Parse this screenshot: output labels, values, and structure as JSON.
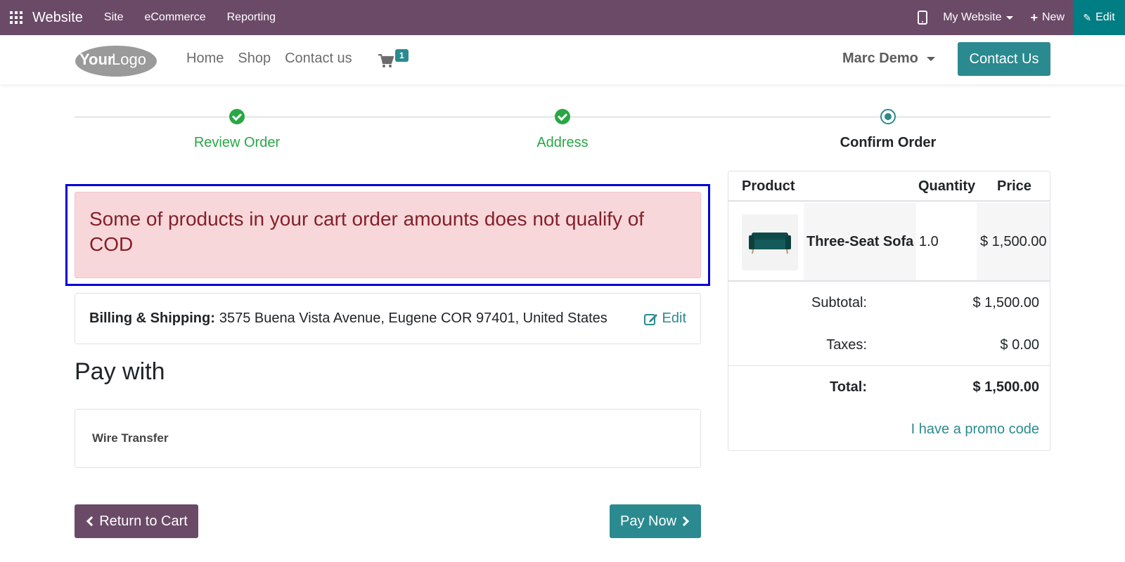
{
  "admin": {
    "brand": "Website",
    "menu": [
      "Site",
      "eCommerce",
      "Reporting"
    ],
    "site_selector": "My Website",
    "new_label": "New",
    "edit_label": "Edit",
    "bar_color": "#6b4a68",
    "edit_color": "#017e84"
  },
  "header": {
    "logo_text_bold": "Your",
    "logo_text": "Logo",
    "nav": [
      "Home",
      "Shop",
      "Contact us"
    ],
    "cart_count": "1",
    "user": "Marc Demo",
    "contact_button": "Contact Us",
    "accent": "#2b8a8f"
  },
  "wizard": {
    "steps": [
      {
        "label": "Review Order",
        "state": "done"
      },
      {
        "label": "Address",
        "state": "done"
      },
      {
        "label": "Confirm Order",
        "state": "current"
      }
    ]
  },
  "alert": {
    "message": "Some of products in your cart order amounts does not qualify of COD"
  },
  "billing": {
    "label": "Billing & Shipping:",
    "address": "3575 Buena Vista Avenue, Eugene COR 97401, United States",
    "edit_label": "Edit"
  },
  "payment": {
    "heading": "Pay with",
    "method": "Wire Transfer",
    "return_button": "Return to Cart",
    "pay_button": "Pay Now"
  },
  "summary": {
    "headers": {
      "product": "Product",
      "quantity": "Quantity",
      "price": "Price"
    },
    "lines": [
      {
        "name": "Three-Seat Sofa",
        "quantity": "1.0",
        "price": "$ 1,500.00"
      }
    ],
    "subtotal_label": "Subtotal:",
    "subtotal": "$ 1,500.00",
    "taxes_label": "Taxes:",
    "taxes": "$ 0.00",
    "total_label": "Total:",
    "total": "$ 1,500.00",
    "promo": "I have a promo code"
  }
}
